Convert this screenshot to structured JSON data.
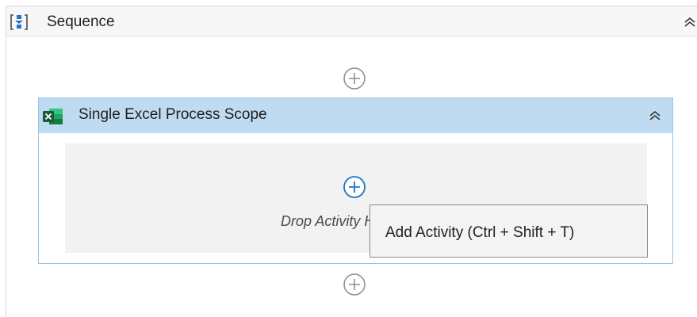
{
  "sequence": {
    "title": "Sequence"
  },
  "scope": {
    "title": "Single Excel Process Scope",
    "drop_text": "Drop Activity Here"
  },
  "tooltip": {
    "text": "Add Activity (Ctrl + Shift + T)"
  },
  "colors": {
    "scope_header": "#bfdbf1",
    "scope_border": "#9fc2e2",
    "plus_active": "#1f73c8",
    "plus_inactive": "#8c8c8c",
    "excel_green": "#1d7044"
  }
}
